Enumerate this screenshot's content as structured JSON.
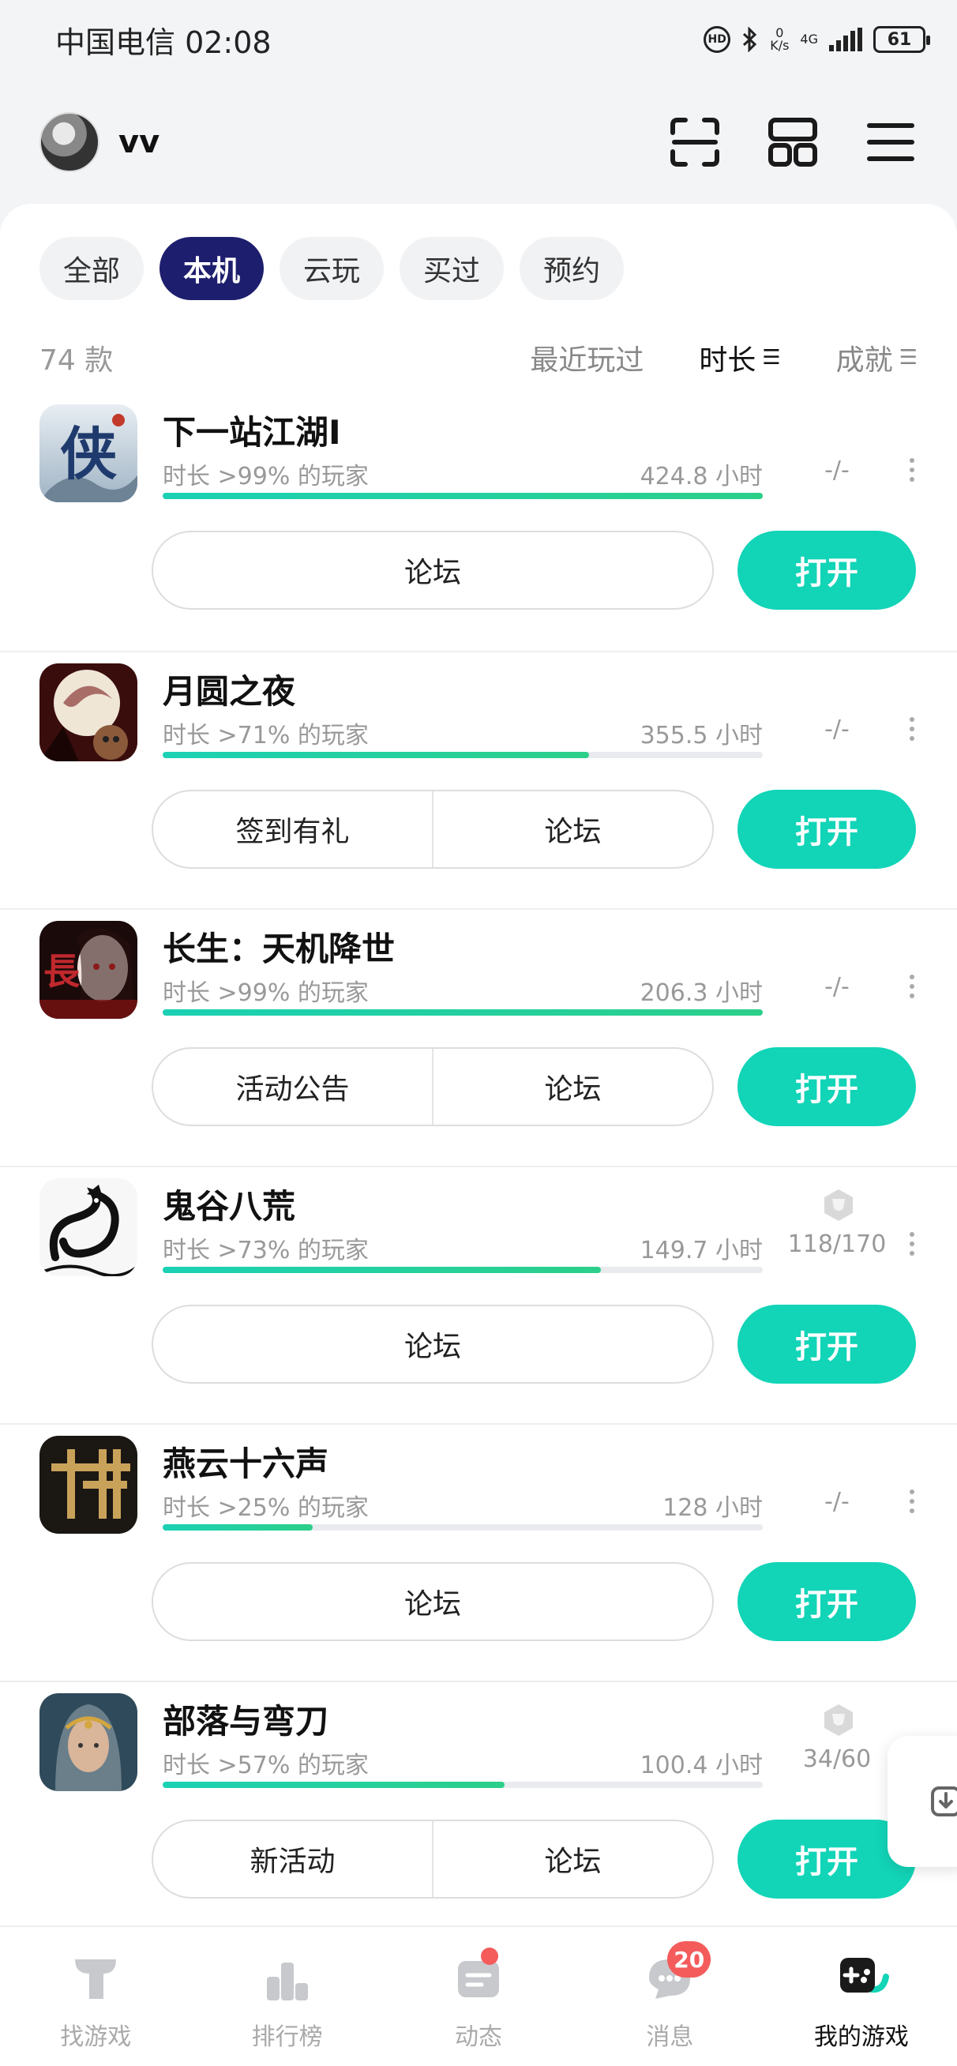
{
  "status_bar": {
    "carrier_time": "中国电信 02:08",
    "net_speed_top": "0",
    "net_speed_bottom": "K/s",
    "network": "4G",
    "battery": "61"
  },
  "header": {
    "username": "vv"
  },
  "filters": [
    "全部",
    "本机",
    "云玩",
    "买过",
    "预约"
  ],
  "active_filter": "本机",
  "list_header": {
    "count": "74 款",
    "sort_recent": "最近玩过",
    "sort_duration": "时长",
    "sort_achievement": "成就"
  },
  "games": [
    {
      "title": "下一站江湖Ⅰ",
      "sub": "时长 >99% 的玩家",
      "hours": "424.8 小时",
      "progress": 1.0,
      "achievement": "-/-",
      "buttons": [
        "论坛"
      ],
      "open": "打开",
      "icon": "xia-icon"
    },
    {
      "title": "月圆之夜",
      "sub": "时长 >71% 的玩家",
      "hours": "355.5 小时",
      "progress": 0.71,
      "achievement": "-/-",
      "buttons": [
        "签到有礼",
        "论坛"
      ],
      "open": "打开",
      "icon": "moon-night-icon"
    },
    {
      "title": "长生：天机降世",
      "sub": "时长 >99% 的玩家",
      "hours": "206.3 小时",
      "progress": 1.0,
      "achievement": "-/-",
      "buttons": [
        "活动公告",
        "论坛"
      ],
      "open": "打开",
      "icon": "changsheng-icon"
    },
    {
      "title": "鬼谷八荒",
      "sub": "时长 >73% 的玩家",
      "hours": "149.7 小时",
      "progress": 0.73,
      "achievement": "118/170",
      "buttons": [
        "论坛"
      ],
      "open": "打开",
      "icon": "dragon-icon"
    },
    {
      "title": "燕云十六声",
      "sub": "时长 >25% 的玩家",
      "hours": "128 小时",
      "progress": 0.25,
      "achievement": "-/-",
      "buttons": [
        "论坛"
      ],
      "open": "打开",
      "icon": "yanyun-icon"
    },
    {
      "title": "部落与弯刀",
      "sub": "时长 >57% 的玩家",
      "hours": "100.4 小时",
      "progress": 0.57,
      "achievement": "34/60",
      "buttons": [
        "新活动",
        "论坛"
      ],
      "open": "打开",
      "icon": "tribe-icon"
    }
  ],
  "nav": [
    {
      "label": "找游戏",
      "icon": "find-game-icon"
    },
    {
      "label": "排行榜",
      "icon": "ranking-icon"
    },
    {
      "label": "动态",
      "icon": "feed-icon"
    },
    {
      "label": "消息",
      "icon": "message-icon",
      "badge": "20"
    },
    {
      "label": "我的游戏",
      "icon": "my-games-icon"
    }
  ],
  "colors": {
    "accent": "#12d4b7",
    "active_chip": "#1e1e6e",
    "badge": "#f45b5b"
  }
}
